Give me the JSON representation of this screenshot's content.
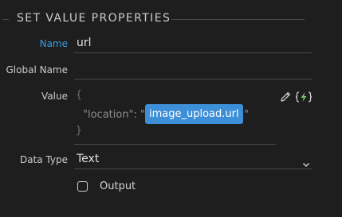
{
  "section": {
    "title": "SET VALUE PROPERTIES"
  },
  "fields": {
    "name": {
      "label": "Name",
      "value": "url"
    },
    "global_name": {
      "label": "Global Name",
      "value": ""
    },
    "value": {
      "label": "Value",
      "open_brace": "{",
      "key_text": "\"location\": \"",
      "expression": "image_upload.url",
      "close_quote": "\"",
      "close_brace": "}"
    },
    "data_type": {
      "label": "Data Type",
      "selected": "Text"
    },
    "output": {
      "label": "Output",
      "checked": false
    }
  },
  "icons": {
    "edit": "pencil-icon",
    "dynamic": "dynamic-data-icon",
    "dropdown": "chevron-down-icon"
  },
  "colors": {
    "background": "#1e1e1e",
    "accent": "#3b9ae1",
    "pill": "#3d8fd8",
    "bolt": "#7dc36b"
  }
}
